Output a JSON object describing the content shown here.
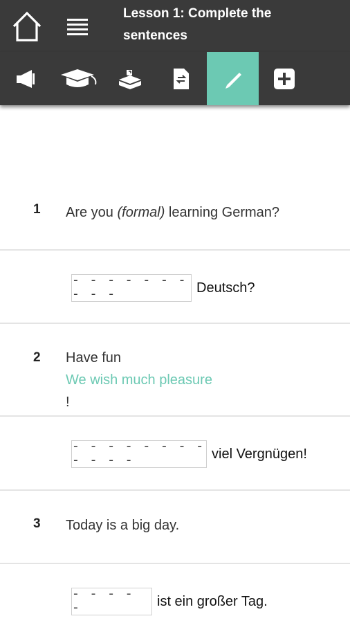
{
  "header": {
    "title": "Lesson 1: Complete the sentences"
  },
  "toolbar": {
    "items": [
      {
        "name": "megaphone-icon"
      },
      {
        "name": "graduation-cap-icon"
      },
      {
        "name": "inbox-hand-icon"
      },
      {
        "name": "document-exchange-icon"
      },
      {
        "name": "pencil-icon",
        "active": true
      },
      {
        "name": "plus-box-icon"
      }
    ],
    "accent_color": "#6cc9b3",
    "bar_color": "#3a3a3a"
  },
  "questions": [
    {
      "number": "1",
      "text_before": "Are you ",
      "text_italic": "(formal)",
      "text_after": " learning German?",
      "blank": "- - - - - - - - - -",
      "answer_suffix": "Deutsch?"
    },
    {
      "number": "2",
      "text": "Have fun",
      "hint": "We wish much pleasure",
      "text_end": "!",
      "blank": "- - - - - - - - - - - -",
      "answer_suffix": "viel Vergnügen!"
    },
    {
      "number": "3",
      "text": "Today is a big day.",
      "blank": "- - - - -",
      "answer_suffix": "ist ein großer Tag."
    }
  ]
}
